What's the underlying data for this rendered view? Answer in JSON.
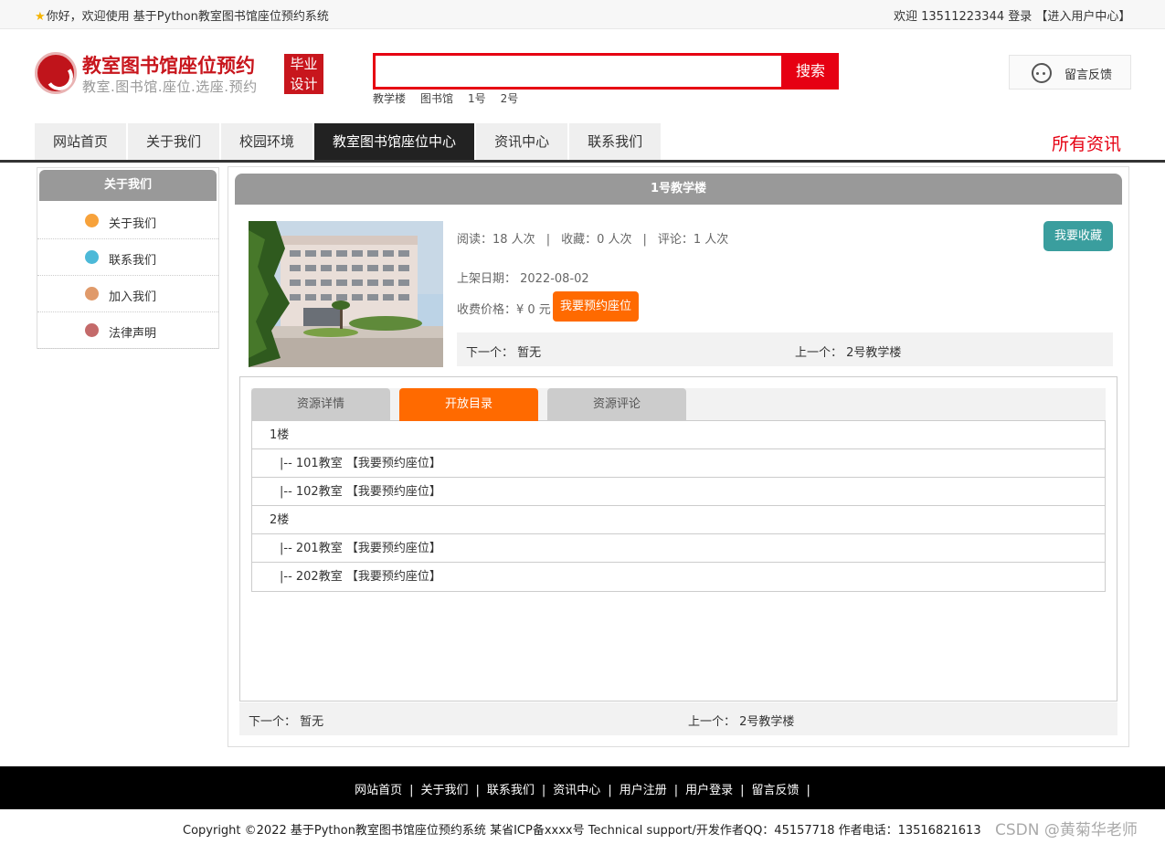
{
  "topbar": {
    "welcome": "你好，欢迎使用 基于Python教室图书馆座位预约系统",
    "right": "欢迎 13511223344 登录 【进入用户中心】"
  },
  "header": {
    "logo_title": "教室图书馆座位预约",
    "logo_sub": "教室.图书馆.座位.选座.预约",
    "badge_line1": "毕业",
    "badge_line2": "设计",
    "search_value": "",
    "search_button": "搜索",
    "hot_keywords": [
      "教学楼",
      "图书馆",
      "1号",
      "2号"
    ],
    "feedback": "留言反馈"
  },
  "nav": {
    "items": [
      "网站首页",
      "关于我们",
      "校园环境",
      "教室图书馆座位中心",
      "资讯中心",
      "联系我们"
    ],
    "active_index": 3,
    "all_news": "所有资讯"
  },
  "sidebar": {
    "title": "关于我们",
    "items": [
      {
        "label": "关于我们",
        "icon": "info-icon",
        "color": "#f7a23b"
      },
      {
        "label": "联系我们",
        "icon": "clipboard-icon",
        "color": "#4cb9d8"
      },
      {
        "label": "加入我们",
        "icon": "lock-icon",
        "color": "#e09a6a"
      },
      {
        "label": "法律声明",
        "icon": "power-icon",
        "color": "#c46a6a"
      }
    ]
  },
  "detail": {
    "title": "1号教学楼",
    "stats": {
      "read": "阅读：18 人次",
      "fav": "收藏：0 人次",
      "comment": "评论：1 人次"
    },
    "fav_button": "我要收藏",
    "date": "上架日期：  2022-08-02",
    "price": "收费价格：¥ 0 元",
    "reserve_button": "我要预约座位",
    "next": "下一个：  暂无",
    "prev": "上一个：  2号教学楼"
  },
  "tabs": {
    "items": [
      "资源详情",
      "开放目录",
      "资源评论"
    ],
    "active_index": 1
  },
  "catalog": [
    {
      "text": "1楼",
      "indent": 0
    },
    {
      "text": "|-- 101教室 【我要预约座位】",
      "indent": 1
    },
    {
      "text": "|-- 102教室 【我要预约座位】",
      "indent": 1
    },
    {
      "text": "2楼",
      "indent": 0
    },
    {
      "text": "|-- 201教室 【我要预约座位】",
      "indent": 1
    },
    {
      "text": "|-- 202教室 【我要预约座位】",
      "indent": 1
    }
  ],
  "footer": {
    "links": [
      "网站首页",
      "关于我们",
      "联系我们",
      "资讯中心",
      "用户注册",
      "用户登录",
      "留言反馈"
    ],
    "copyright": "Copyright ©2022 基于Python教室图书馆座位预约系统 某省ICP备xxxx号     Technical support/开发作者QQ：45157718      作者电话：13516821613",
    "watermark": "CSDN @黄菊华老师"
  }
}
